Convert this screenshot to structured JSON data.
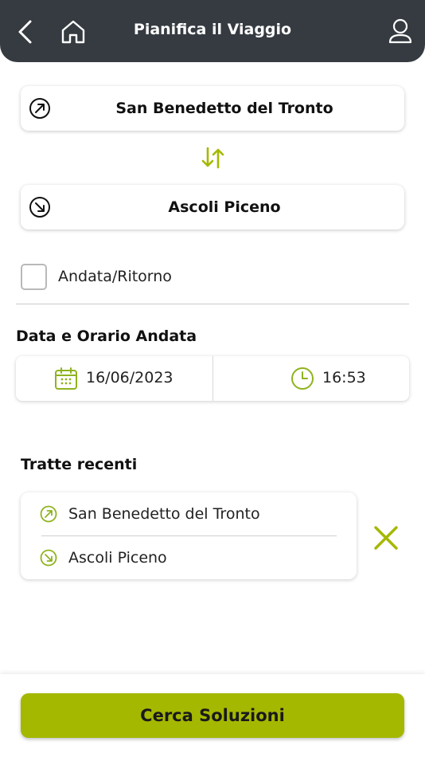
{
  "header": {
    "title": "Pianifica il Viaggio",
    "back_icon": "chevron-left-icon",
    "home_icon": "home-icon",
    "profile_icon": "user-icon"
  },
  "route": {
    "origin": "San Benedetto del Tronto",
    "destination": "Ascoli Piceno",
    "origin_icon": "arrow-up-right-circle-icon",
    "destination_icon": "arrow-down-right-circle-icon",
    "swap_icon": "swap-vertical-icon"
  },
  "round_trip": {
    "label": "Andata/Ritorno",
    "checked": false
  },
  "departure": {
    "section_title": "Data e Orario Andata",
    "date": "16/06/2023",
    "time": "16:53",
    "date_icon": "calendar-icon",
    "time_icon": "clock-icon"
  },
  "recent": {
    "section_title": "Tratte recenti",
    "items": [
      {
        "origin": "San Benedetto del Tronto",
        "destination": "Ascoli Piceno"
      }
    ],
    "delete_icon": "close-icon"
  },
  "search_button": {
    "label": "Cerca Soluzioni"
  },
  "colors": {
    "header_bg": "#353b40",
    "accent": "#a5b800",
    "icon_green": "#8fb31e"
  }
}
